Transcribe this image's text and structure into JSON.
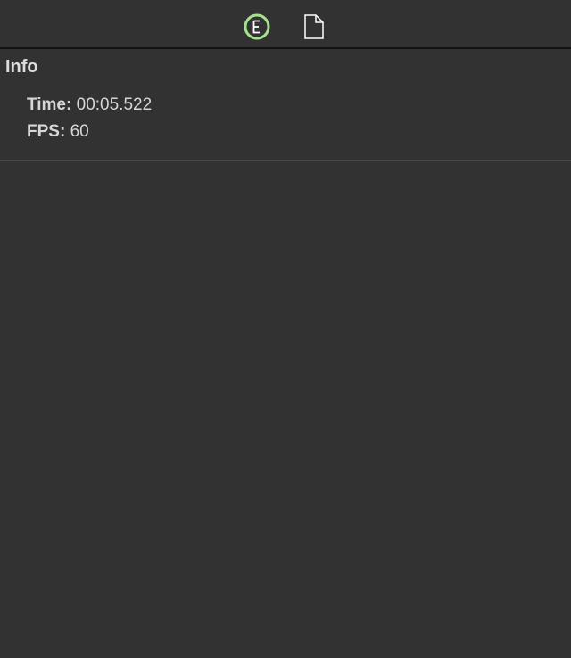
{
  "toolbar": {
    "buttons": [
      {
        "icon": "circled-e-icon",
        "accent": "#a5e28f"
      },
      {
        "icon": "document-icon",
        "color": "#ffffff"
      }
    ]
  },
  "info_panel": {
    "title": "Info",
    "time_key": "Time:",
    "time_value": "00:05.522",
    "fps_key": "FPS:",
    "fps_value": "60"
  },
  "colors": {
    "background": "#323232",
    "toolbar_border": "#141414",
    "divider": "#4a4a4a",
    "text": "#d6d6d6"
  }
}
